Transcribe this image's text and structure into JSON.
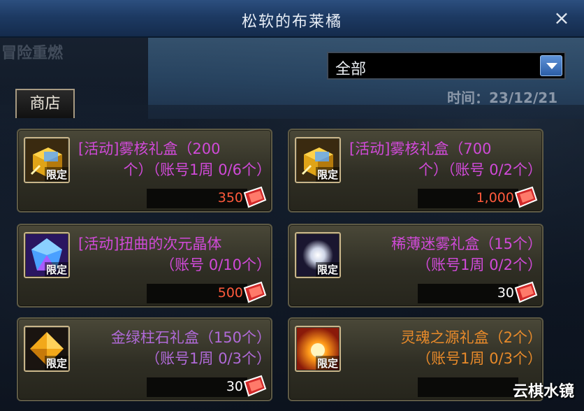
{
  "window": {
    "title": "松软的布莱橘",
    "close_label": "×"
  },
  "filter": {
    "selected": "全部"
  },
  "time_label": "时间：23/12/21",
  "tab": {
    "label": "商店"
  },
  "background_text": [
    "冒险重燃"
  ],
  "items": [
    {
      "line1": "[活动]雾核礼盒（200",
      "line2": "个）（账号1周 0/6个）",
      "limited": "限定",
      "price": "350",
      "name_color": "#d04ad8",
      "price_color": "#ff5a3c",
      "icon": "gold-cube-icon"
    },
    {
      "line1": "[活动]雾核礼盒（700",
      "line2": "个）（账号 0/2个）",
      "limited": "限定",
      "price": "1,000",
      "name_color": "#d04ad8",
      "price_color": "#ff5a3c",
      "icon": "gold-cube-icon"
    },
    {
      "line1": "[活动]扭曲的次元晶体",
      "line2": "（账号 0/10个）",
      "limited": "限定",
      "price": "500",
      "name_color": "#d04ad8",
      "price_color": "#ff5a3c",
      "icon": "dimension-crystal-icon"
    },
    {
      "line1": "稀薄迷雾礼盒（15个）",
      "line2": "（账号1周 0/2个）",
      "limited": "限定",
      "price": "30",
      "name_color": "#d04ad8",
      "price_color": "#ffffff",
      "icon": "mist-orb-icon"
    },
    {
      "line1": "金绿柱石礼盒（150个）",
      "line2": "（账号1周 0/3个）",
      "limited": "限定",
      "price": "30",
      "name_color": "#b06ad8",
      "price_color": "#ffffff",
      "icon": "chrysoberyl-gem-icon"
    },
    {
      "line1": "灵魂之源礼盒（2个）",
      "line2": "（账号1周 0/3个）",
      "limited": "限定",
      "price": "",
      "name_color": "#e88a2a",
      "price_color": "#ffffff",
      "icon": "soul-source-icon"
    }
  ],
  "watermark": "云棋水镜"
}
